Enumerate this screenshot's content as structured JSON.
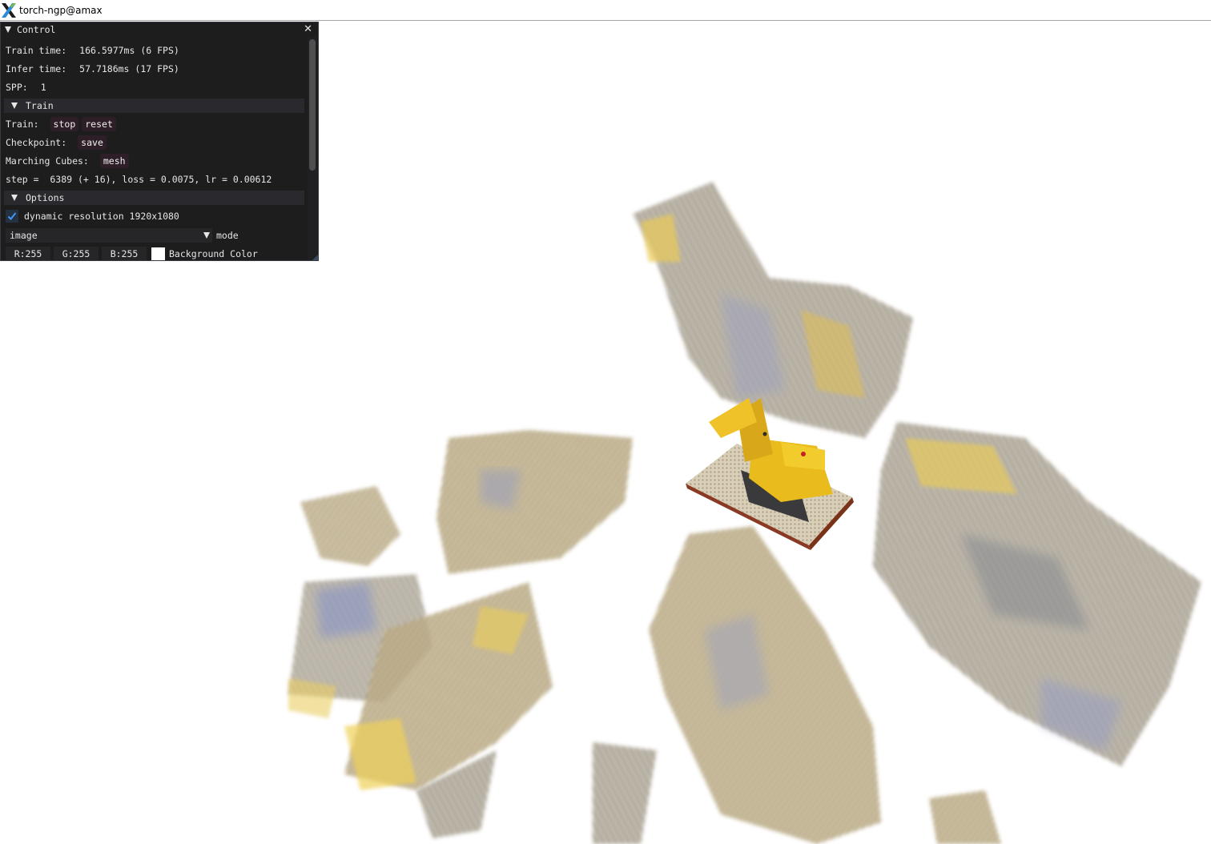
{
  "window": {
    "title": "torch-ngp@amax",
    "logo": "x11-logo-icon"
  },
  "panel": {
    "title": "Control",
    "close_glyph": "✕",
    "train_time_label": "Train time:",
    "train_time_value": "166.5977ms (6 FPS)",
    "infer_time_label": "Infer time:",
    "infer_time_value": "57.7186ms (17 FPS)",
    "spp_label": "SPP:",
    "spp_value": "1",
    "train_section": "Train",
    "train_label": "Train:",
    "stop_button": "stop",
    "reset_button": "reset",
    "checkpoint_label": "Checkpoint:",
    "save_button": "save",
    "marching_label": "Marching Cubes:",
    "mesh_button": "mesh",
    "status_line": "step =  6389 (+ 16), loss = 0.0075, lr = 0.00612",
    "options_section": "Options",
    "dynamic_resolution_label": "dynamic resolution 1920x1080",
    "dynamic_resolution_checked": true,
    "mode_value": "image",
    "mode_label": "mode",
    "r_value": "R:255",
    "g_value": "G:255",
    "b_value": "B:255",
    "background_label": "Background Color",
    "background_color": "#ffffff"
  },
  "colors": {
    "panel_bg": "#0f0f0f",
    "section_bg": "#2a2a2e",
    "button_bg": "#2e1e28",
    "checkbox_bg": "#243141",
    "check_mark": "#4296fa",
    "accent_yellow": "#e8c23a"
  }
}
